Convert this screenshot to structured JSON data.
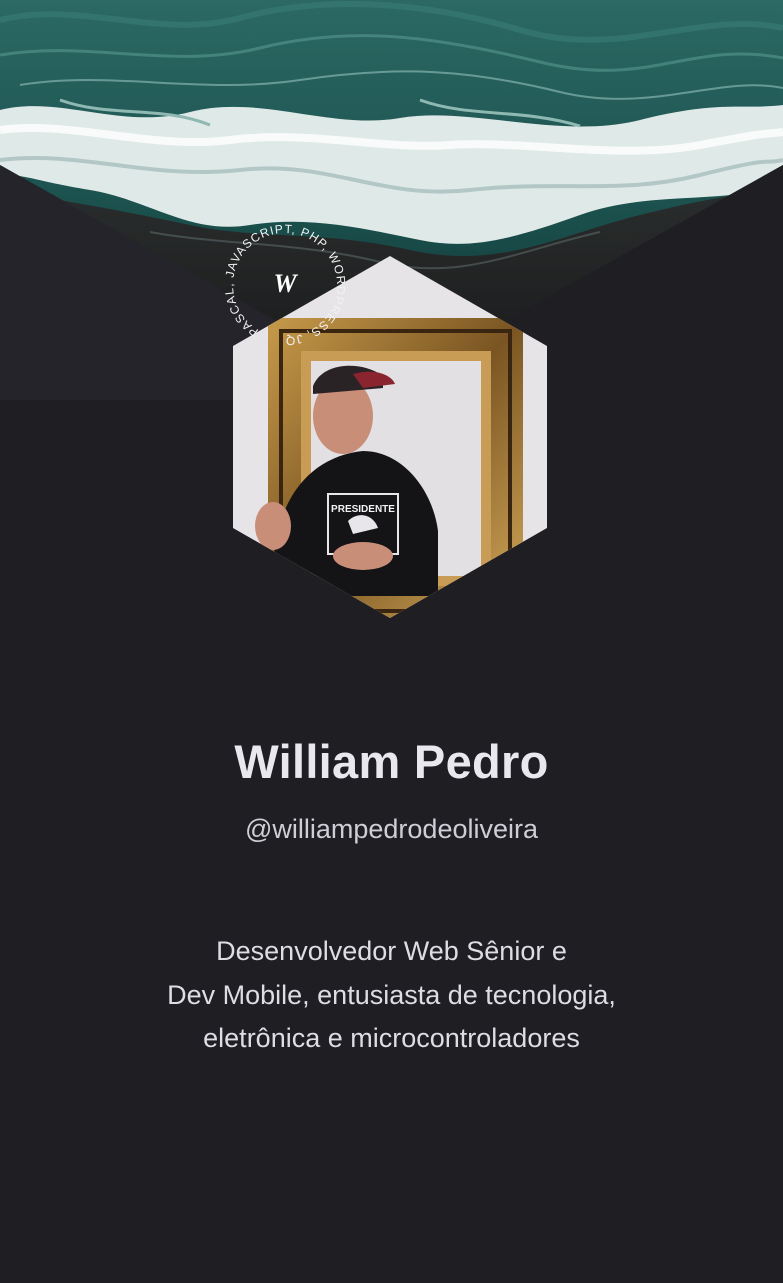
{
  "profile": {
    "name": "William Pedro",
    "handle": "@williampedrodeoliveira",
    "bio_lines": [
      "Desenvolvedor Web Sênior e",
      "Dev Mobile, entusiasta de tecnologia,",
      "eletrônica e microcontroladores"
    ],
    "photo_shirt_text": "PRESIDENTE"
  },
  "badge": {
    "monogram": "W",
    "ring_text": "PASCAL, JAVASCRIPT, PHP, WORDPRESS, JQ"
  },
  "colors": {
    "background": "#1f1e23",
    "ocean": "#1a4f4c",
    "foam": "#e8efee",
    "sand": "#1c1c1d",
    "text": "#e9e8ee"
  }
}
